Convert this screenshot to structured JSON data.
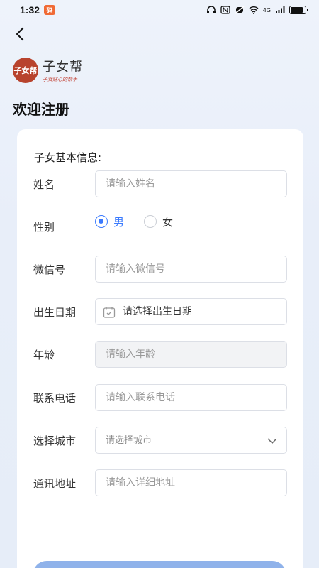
{
  "status_bar": {
    "time": "1:32",
    "app_badge": "码",
    "network": "4G"
  },
  "header": {
    "logo_mark": "子女帮",
    "logo_name": "子女帮",
    "logo_slogan": "子女贴心的帮手",
    "title": "欢迎注册"
  },
  "form": {
    "section_title": "子女基本信息:",
    "name": {
      "label": "姓名",
      "placeholder": "请输入姓名"
    },
    "gender": {
      "label": "性别",
      "options": [
        "男",
        "女"
      ],
      "selected": "男"
    },
    "wechat": {
      "label": "微信号",
      "placeholder": "请输入微信号"
    },
    "birthday": {
      "label": "出生日期",
      "placeholder": "请选择出生日期"
    },
    "age": {
      "label": "年龄",
      "placeholder": "请输入年龄"
    },
    "phone": {
      "label": "联系电话",
      "placeholder": "请输入联系电话"
    },
    "city": {
      "label": "选择城市",
      "placeholder": "请选择城市"
    },
    "address": {
      "label": "通讯地址",
      "placeholder": "请输入详细地址"
    }
  },
  "colors": {
    "accent": "#3a7afe",
    "submit": "#8fb2ea",
    "logo": "#b8432d"
  },
  "icons": {
    "back": "chevron-left-icon",
    "date": "calendar-icon",
    "dropdown": "chevron-down-icon"
  }
}
